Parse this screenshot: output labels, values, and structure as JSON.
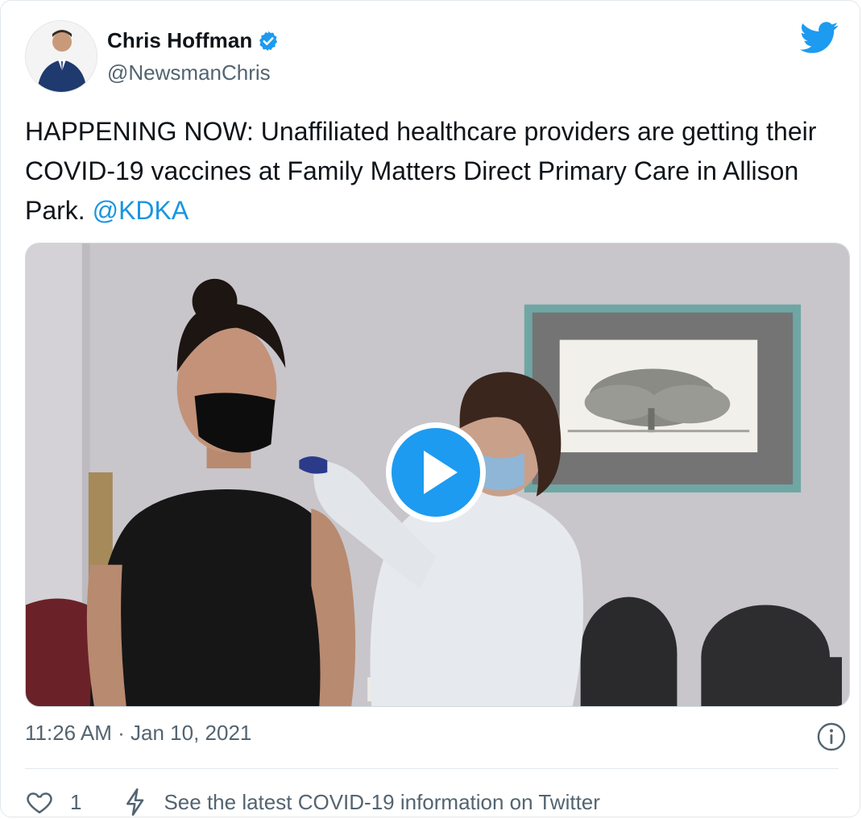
{
  "author": {
    "display_name": "Chris Hoffman",
    "handle": "@NewsmanChris",
    "verified": true,
    "avatar_icon": "avatar-photo"
  },
  "tweet": {
    "text_parts": {
      "body": "HAPPENING NOW: Unaffiliated healthcare providers are getting their COVID-19 vaccines at Family Matters Direct Primary Care in Allison Park. ",
      "mention": "@KDKA"
    },
    "media": {
      "type": "video",
      "play_icon": "play-icon"
    },
    "timestamp": "11:26 AM · Jan 10, 2021"
  },
  "actions": {
    "like_count": "1",
    "covid_info": "See the latest COVID-19 information on Twitter"
  },
  "icons": {
    "brand": "twitter-bird-icon",
    "verified": "verified-badge-icon",
    "info": "info-icon",
    "like": "heart-icon",
    "covid": "lightning-bolt-icon"
  },
  "colors": {
    "brand": "#1d9bf0",
    "link": "#1b95e0",
    "secondary_text": "#536471",
    "play_button": "#1d9bf0"
  }
}
